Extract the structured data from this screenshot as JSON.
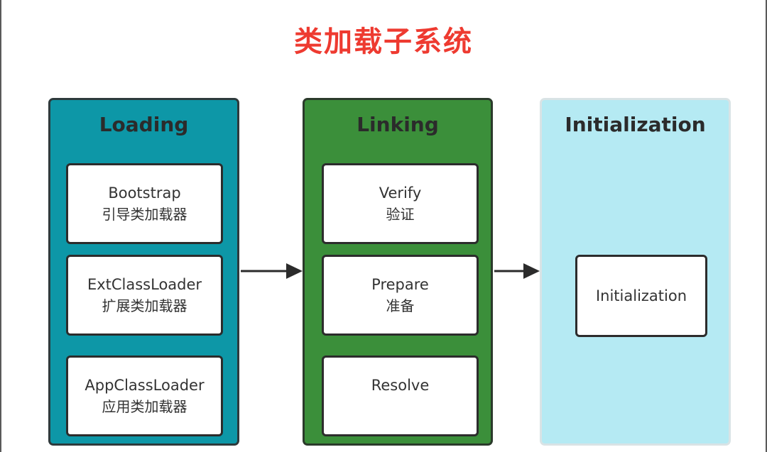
{
  "title": "类加载子系统",
  "colors": {
    "title": "#ee3a30",
    "loading_bg": "#0d97a7",
    "linking_bg": "#3b8f3a",
    "initialization_bg": "#b5eaf3"
  },
  "panels": [
    {
      "name": "Loading",
      "boxes": [
        {
          "label": "Bootstrap",
          "sub": "引导类加载器"
        },
        {
          "label": "ExtClassLoader",
          "sub": "扩展类加载器"
        },
        {
          "label": "AppClassLoader",
          "sub": "应用类加载器"
        }
      ]
    },
    {
      "name": "Linking",
      "boxes": [
        {
          "label": "Verify",
          "sub": "验证"
        },
        {
          "label": "Prepare",
          "sub": "准备"
        },
        {
          "label": "Resolve",
          "sub": ""
        }
      ]
    },
    {
      "name": "Initialization",
      "boxes": [
        {
          "label": "Initialization",
          "sub": ""
        }
      ]
    }
  ]
}
